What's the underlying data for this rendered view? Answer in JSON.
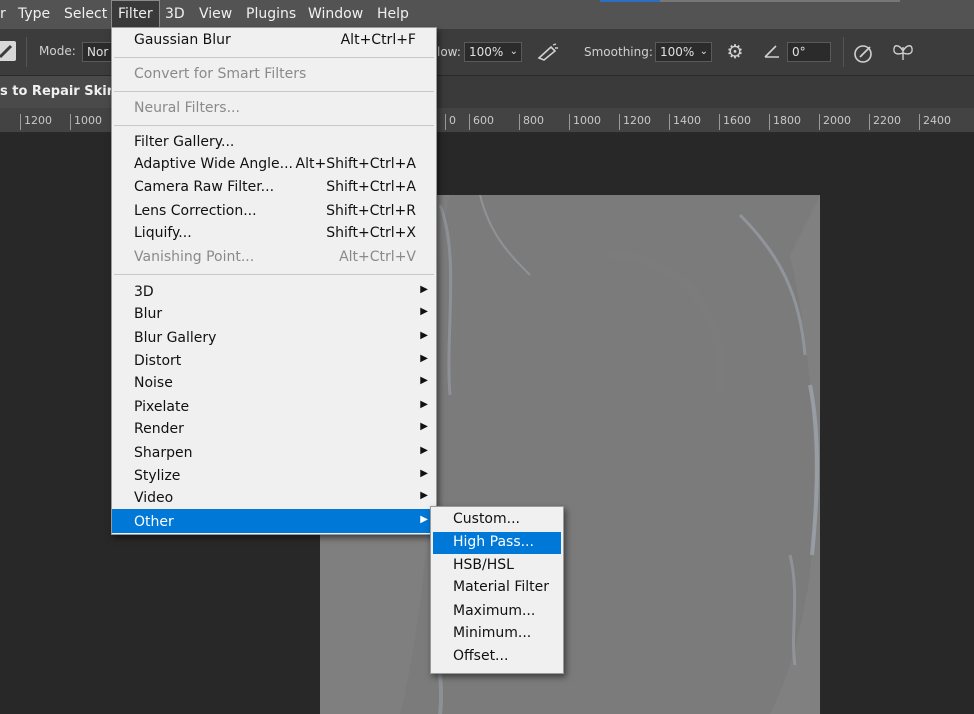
{
  "menubar": {
    "items": [
      "r",
      "Type",
      "Select",
      "Filter",
      "3D",
      "View",
      "Plugins",
      "Window",
      "Help"
    ],
    "active": "Filter"
  },
  "options": {
    "mode_label": "Mode:",
    "mode_value": "Nor",
    "flow_label": "low:",
    "flow_value": "100%",
    "smoothing_label": "Smoothing:",
    "smoothing_value": "100%",
    "angle_value": "0°"
  },
  "doc_tab": {
    "title": "s to Repair Skin -"
  },
  "ruler": {
    "left_ticks": [
      "1200",
      "1000"
    ],
    "right_ticks": [
      "0",
      "600",
      "800",
      "1000",
      "1200",
      "1400",
      "1600",
      "1800",
      "2000",
      "2200",
      "2400"
    ]
  },
  "filter_menu": {
    "items": [
      {
        "label": "Gaussian Blur",
        "shortcut": "Alt+Ctrl+F",
        "state": "enabled"
      },
      {
        "label": "Convert for Smart Filters",
        "shortcut": "",
        "state": "disabled"
      },
      {
        "label": "Neural Filters...",
        "shortcut": "",
        "state": "disabled"
      },
      {
        "label": "Filter Gallery...",
        "shortcut": "",
        "state": "enabled"
      },
      {
        "label": "Adaptive Wide Angle...",
        "shortcut": "Alt+Shift+Ctrl+A",
        "state": "enabled"
      },
      {
        "label": "Camera Raw Filter...",
        "shortcut": "Shift+Ctrl+A",
        "state": "enabled"
      },
      {
        "label": "Lens Correction...",
        "shortcut": "Shift+Ctrl+R",
        "state": "enabled"
      },
      {
        "label": "Liquify...",
        "shortcut": "Shift+Ctrl+X",
        "state": "enabled"
      },
      {
        "label": "Vanishing Point...",
        "shortcut": "Alt+Ctrl+V",
        "state": "disabled"
      },
      {
        "label": "3D",
        "shortcut": "",
        "state": "submenu"
      },
      {
        "label": "Blur",
        "shortcut": "",
        "state": "submenu"
      },
      {
        "label": "Blur Gallery",
        "shortcut": "",
        "state": "submenu"
      },
      {
        "label": "Distort",
        "shortcut": "",
        "state": "submenu"
      },
      {
        "label": "Noise",
        "shortcut": "",
        "state": "submenu"
      },
      {
        "label": "Pixelate",
        "shortcut": "",
        "state": "submenu"
      },
      {
        "label": "Render",
        "shortcut": "",
        "state": "submenu"
      },
      {
        "label": "Sharpen",
        "shortcut": "",
        "state": "submenu"
      },
      {
        "label": "Stylize",
        "shortcut": "",
        "state": "submenu"
      },
      {
        "label": "Video",
        "shortcut": "",
        "state": "submenu"
      },
      {
        "label": "Other",
        "shortcut": "",
        "state": "submenu-highlighted"
      }
    ]
  },
  "other_submenu": {
    "items": [
      "Custom...",
      "High Pass...",
      "HSB/HSL",
      "Material Filter",
      "Maximum...",
      "Minimum...",
      "Offset..."
    ],
    "highlighted": "High Pass..."
  },
  "colors": {
    "menu_highlight": "#0078d7",
    "menubar_bg": "#535353",
    "canvas_bg": "#282828",
    "document_gray": "#7b7b7b"
  }
}
